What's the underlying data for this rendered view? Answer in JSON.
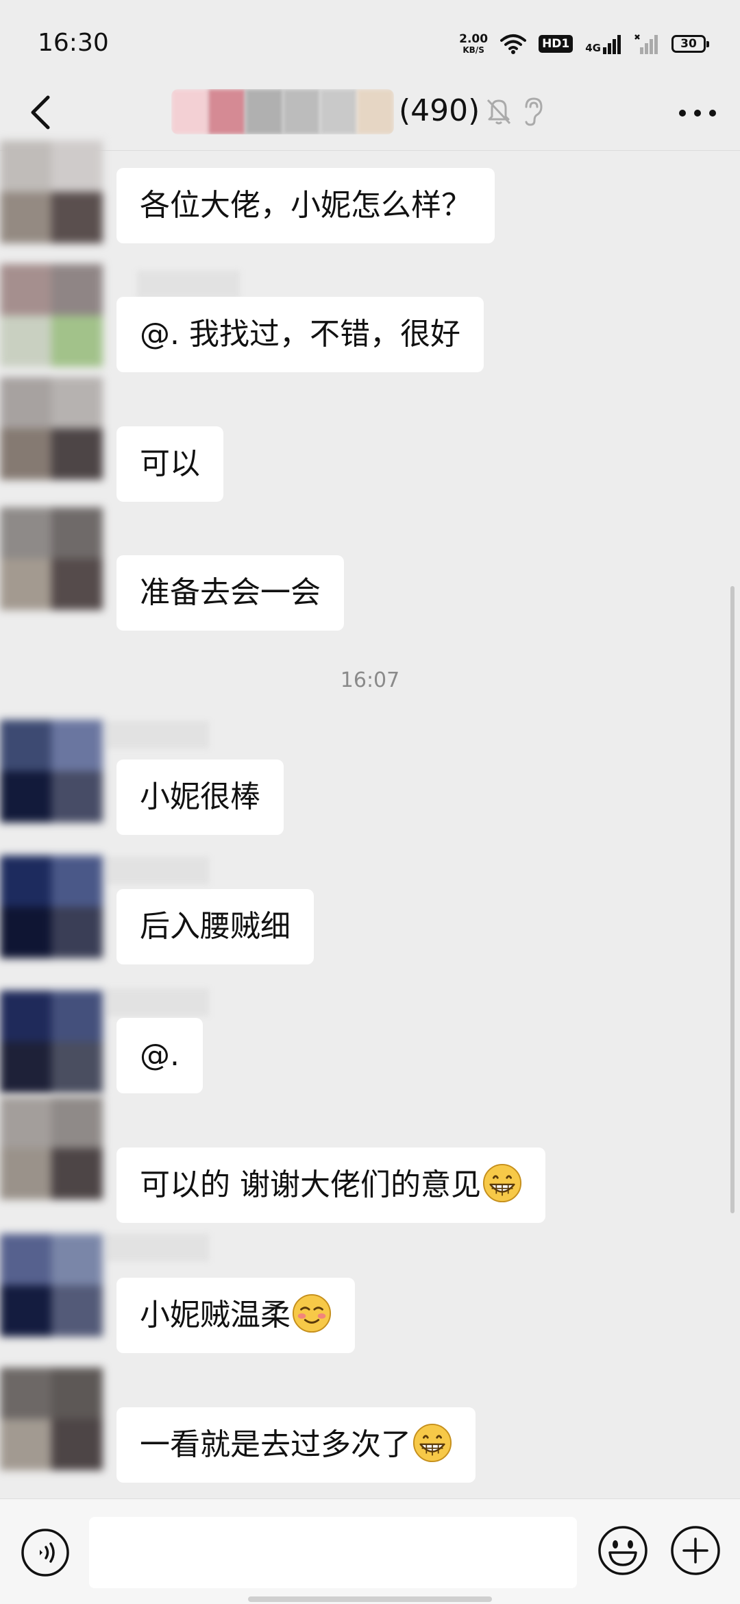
{
  "status_bar": {
    "time": "16:30",
    "net_speed": "2.00",
    "net_speed_unit": "KB/S",
    "hd_badge": "HD1",
    "network": "4G",
    "battery": "30"
  },
  "header": {
    "member_count": "(490)",
    "icons": [
      "back-icon",
      "mute-bell-icon",
      "earpiece-icon",
      "more-icon"
    ]
  },
  "timestamp": "16:07",
  "messages": [
    {
      "text": "各位大佬，小妮怎么样？"
    },
    {
      "text": "@. 我找过，不错，很好"
    },
    {
      "text": "可以"
    },
    {
      "text": "准备去会一会"
    },
    {
      "text": "小妮很棒"
    },
    {
      "text": "后入腰贼细"
    },
    {
      "text": "@."
    },
    {
      "text": "可以的 谢谢大佬们的意见",
      "emoji": "grinning-face"
    },
    {
      "text": "小妮贼温柔",
      "emoji": "smiling-face"
    },
    {
      "text": "一看就是去过多次了",
      "emoji": "grinning-face"
    }
  ],
  "input_bar": {
    "placeholder": "",
    "icons": [
      "voice-icon",
      "emoji-icon",
      "plus-icon"
    ]
  },
  "colors": {
    "background": "#ededed",
    "bubble": "#ffffff",
    "emoji_yellow": "#f7c948"
  }
}
